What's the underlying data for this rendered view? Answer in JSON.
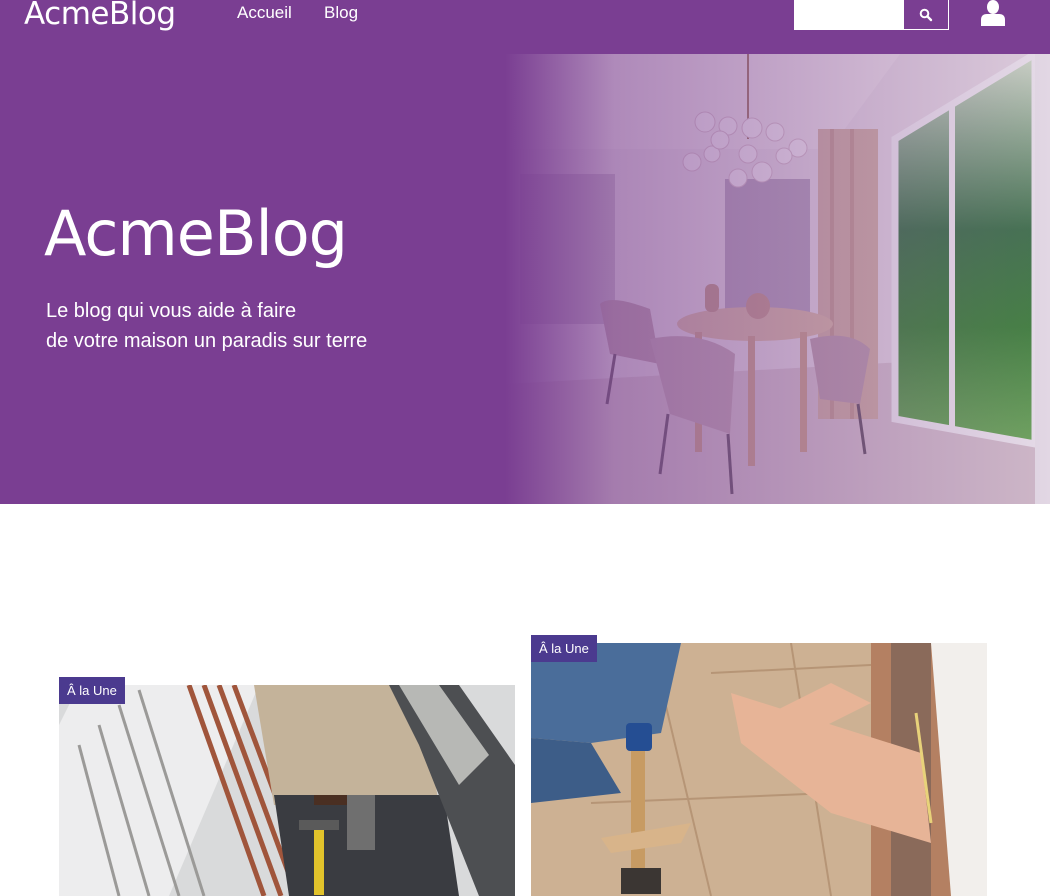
{
  "header": {
    "logo": "AcmeBlog",
    "nav": [
      {
        "label": "Accueil"
      },
      {
        "label": "Blog"
      }
    ],
    "search": {
      "placeholder": "",
      "value": "",
      "button_icon": "search-icon"
    },
    "user_icon": "user-icon"
  },
  "hero": {
    "title": "AcmeBlog",
    "subtitle_line1": "Le blog qui vous aide à faire",
    "subtitle_line2": "de votre maison un paradis sur terre"
  },
  "cards": [
    {
      "badge": "Â la Une"
    },
    {
      "badge": "Â la Une"
    }
  ],
  "colors": {
    "brand": "#7a3e92",
    "badge": "#4b3a8f",
    "white": "#ffffff"
  }
}
